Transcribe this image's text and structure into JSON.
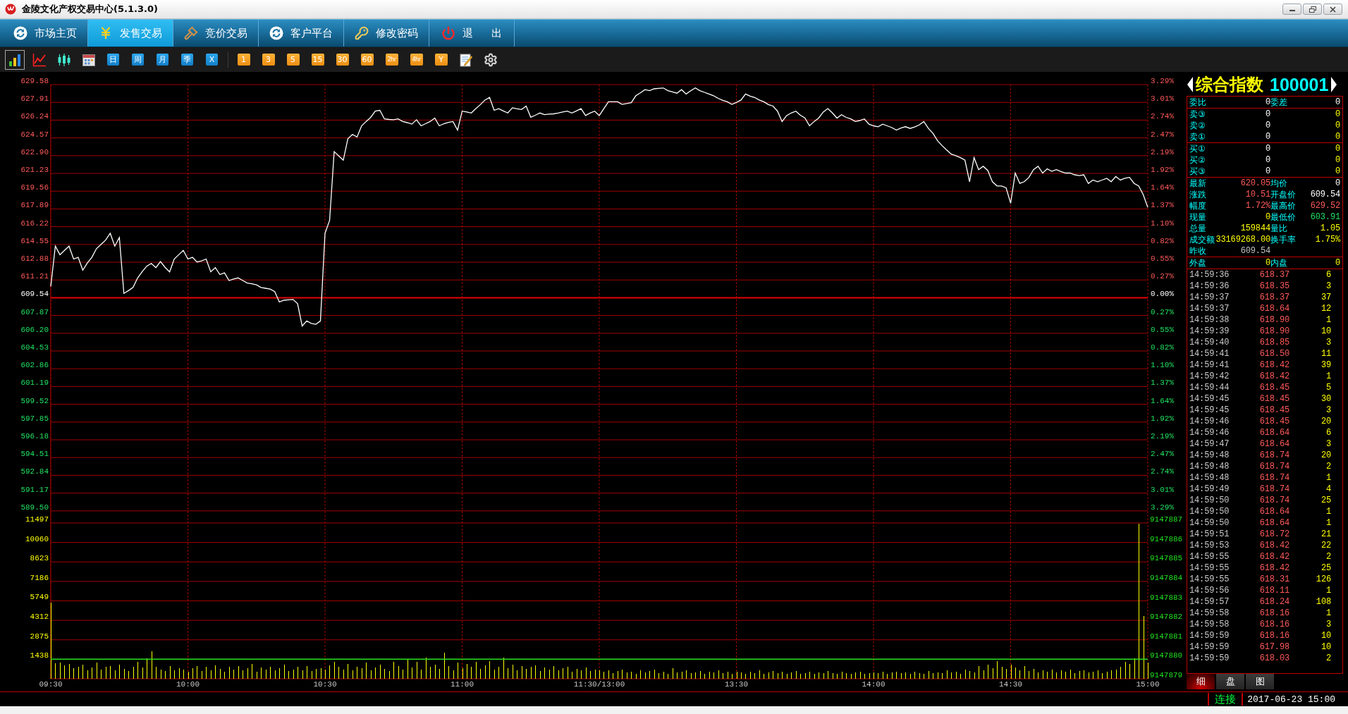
{
  "window": {
    "title": "金陵文化产权交易中心(5.1.3.0)"
  },
  "nav_tabs": [
    {
      "label": "市场主页",
      "selected": false
    },
    {
      "label": "发售交易",
      "selected": true
    },
    {
      "label": "竞价交易",
      "selected": false
    },
    {
      "label": "客户平台",
      "selected": false
    },
    {
      "label": "修改密码",
      "selected": false
    },
    {
      "label": "退 出",
      "selected": false
    }
  ],
  "toolbar": {
    "view_buttons": [
      {
        "selected": true
      },
      {
        "selected": false
      },
      {
        "selected": false
      },
      {
        "selected": false
      }
    ],
    "period_buttons": [
      "日",
      "周",
      "月",
      "季",
      "X"
    ],
    "interval_buttons": [
      "1",
      "3",
      "5",
      "15",
      "30",
      "60",
      "2hr",
      "4hr",
      "Y"
    ]
  },
  "price_chart": {
    "right_labels": [
      "3.29%",
      "3.01%",
      "2.74%",
      "2.47%",
      "2.19%",
      "1.92%",
      "1.64%",
      "1.37%",
      "1.10%",
      "0.82%",
      "0.55%",
      "0.27%",
      "0.00%",
      "0.27%",
      "0.55%",
      "0.82%",
      "1.10%",
      "1.37%",
      "1.64%",
      "1.92%",
      "2.19%",
      "2.47%",
      "2.74%",
      "3.01%",
      "3.29%"
    ],
    "chart_data": {
      "type": "line",
      "grid": true,
      "ylim": [
        589.5,
        629.58
      ],
      "yticks": [
        {
          "value": 629.58,
          "label": "629.58"
        },
        {
          "value": 627.91,
          "label": "627.91"
        },
        {
          "value": 626.24,
          "label": "626.24"
        },
        {
          "value": 624.57,
          "label": "624.57"
        },
        {
          "value": 622.9,
          "label": "622.90"
        },
        {
          "value": 621.23,
          "label": "621.23"
        },
        {
          "value": 619.56,
          "label": "619.56"
        },
        {
          "value": 617.89,
          "label": "617.89"
        },
        {
          "value": 616.22,
          "label": "616.22"
        },
        {
          "value": 614.55,
          "label": "614.55"
        },
        {
          "value": 612.88,
          "label": "612.88"
        },
        {
          "value": 611.21,
          "label": "611.21"
        },
        {
          "value": 609.54,
          "label": "609.54"
        },
        {
          "value": 607.87,
          "label": "607.87"
        },
        {
          "value": 606.2,
          "label": "606.20"
        },
        {
          "value": 604.53,
          "label": "604.53"
        },
        {
          "value": 602.86,
          "label": "602.86"
        },
        {
          "value": 601.19,
          "label": "601.19"
        },
        {
          "value": 599.52,
          "label": "599.52"
        },
        {
          "value": 597.85,
          "label": "597.85"
        },
        {
          "value": 596.18,
          "label": "596.18"
        },
        {
          "value": 594.51,
          "label": "594.51"
        },
        {
          "value": 592.84,
          "label": "592.84"
        },
        {
          "value": 591.17,
          "label": "591.17"
        },
        {
          "value": 589.5,
          "label": "589.50"
        }
      ],
      "categories": [
        null,
        null,
        null,
        null,
        null,
        null,
        null,
        null,
        null,
        null,
        null,
        null,
        null,
        null,
        null,
        null,
        null,
        null,
        null,
        null,
        null,
        null,
        null,
        null,
        null,
        null,
        null,
        null,
        null,
        null,
        null,
        null,
        null,
        null,
        null,
        null,
        null,
        null,
        null,
        null,
        null,
        null,
        null,
        null,
        null,
        null,
        null,
        null,
        null,
        null,
        null,
        null,
        null,
        null,
        null,
        null,
        null,
        null,
        null,
        null,
        null,
        null,
        null,
        null,
        null,
        null,
        null,
        null,
        null,
        null,
        null,
        null,
        null,
        null,
        null,
        null,
        null,
        null,
        null,
        null,
        null,
        null,
        null,
        null,
        null,
        null,
        null,
        null,
        null,
        null,
        null,
        null,
        null,
        null,
        null,
        null,
        null,
        null,
        null,
        null,
        null,
        null,
        null,
        null,
        null,
        null,
        null,
        null,
        null,
        null,
        null,
        null,
        null,
        null,
        null,
        null,
        null,
        null,
        null,
        null,
        null,
        null,
        null,
        null,
        null,
        null,
        null,
        null,
        null,
        null,
        null,
        null,
        null,
        null,
        null,
        null,
        null,
        null,
        null,
        null,
        null,
        null,
        null,
        null,
        null,
        null,
        null,
        null,
        null,
        null,
        null,
        null,
        null,
        null,
        null,
        null,
        null,
        null,
        null,
        null,
        null,
        null,
        null,
        null,
        null,
        null,
        null,
        null,
        null,
        null,
        null,
        null,
        null,
        null,
        null,
        null,
        null,
        null,
        null,
        null,
        null,
        null,
        null,
        null,
        null,
        null,
        null,
        null,
        null,
        null,
        null,
        null,
        null,
        null,
        null,
        null,
        null,
        null,
        null,
        null,
        null,
        null,
        null,
        null,
        null,
        null,
        null,
        null,
        null,
        null,
        null,
        null,
        null,
        null,
        null,
        null,
        null,
        null,
        null,
        null,
        null,
        null,
        null,
        null,
        null,
        null,
        null,
        null,
        null,
        null,
        null,
        null,
        null,
        null,
        null,
        null,
        null,
        null,
        null,
        null,
        null
      ],
      "series": [
        {
          "color": "#ffffff",
          "values": [
            610.6,
            614.39,
            613.58,
            613.99,
            614.39,
            613.18,
            613.34,
            612.13,
            612.8,
            613.34,
            614.15,
            614.55,
            614.96,
            615.6,
            614.39,
            615.2,
            609.95,
            610.2,
            610.51,
            611.4,
            612.0,
            612.5,
            612.77,
            612.37,
            612.94,
            612.4,
            611.97,
            613.18,
            613.58,
            613.99,
            613.18,
            613.34,
            612.9,
            613.0,
            613.18,
            611.97,
            612.37,
            611.72,
            611.88,
            611.16,
            611.3,
            611.4,
            611.16,
            610.92,
            610.85,
            610.75,
            610.51,
            610.43,
            610.35,
            610.11,
            609.14,
            609.3,
            609.34,
            609.38,
            608.98,
            606.88,
            607.36,
            607.12,
            607.04,
            607.36,
            615.6,
            616.81,
            623.28,
            622.87,
            622.47,
            624.49,
            624.89,
            624.65,
            625.7,
            626.11,
            626.5,
            627.08,
            627.16,
            626.35,
            626.3,
            626.27,
            626.35,
            626.11,
            626.0,
            625.86,
            626.27,
            625.7,
            625.9,
            626.11,
            626.43,
            625.7,
            625.9,
            626.02,
            626.11,
            625.3,
            627.08,
            627.0,
            626.91,
            627.32,
            627.7,
            628.13,
            628.37,
            627.16,
            627.32,
            627.1,
            626.91,
            627.4,
            627.3,
            627.24,
            627.56,
            626.51,
            626.7,
            626.91,
            626.75,
            626.8,
            626.83,
            626.91,
            627.0,
            627.08,
            626.91,
            627.1,
            627.32,
            626.67,
            626.9,
            627.08,
            626.67,
            627.32,
            627.96,
            627.96,
            627.96,
            627.72,
            627.8,
            627.88,
            628.53,
            628.8,
            629.1,
            629.01,
            629.18,
            629.22,
            629.26,
            629.01,
            628.9,
            628.77,
            629.1,
            628.69,
            629.0,
            629.26,
            629.01,
            628.85,
            628.7,
            628.53,
            628.29,
            628.1,
            627.96,
            627.72,
            627.9,
            628.13,
            628.69,
            628.5,
            628.37,
            628.13,
            627.96,
            627.7,
            627.56,
            627.08,
            626.11,
            626.67,
            626.91,
            627.08,
            626.7,
            626.43,
            625.7,
            626.11,
            626.43,
            627.0,
            627.32,
            626.91,
            626.43,
            626.75,
            626.5,
            626.35,
            626.11,
            626.2,
            626.35,
            625.86,
            625.7,
            625.62,
            625.86,
            625.7,
            625.54,
            625.3,
            625.5,
            625.62,
            625.46,
            625.6,
            625.78,
            626.11,
            625.46,
            625.0,
            624.3,
            623.84,
            623.44,
            623.04,
            622.9,
            622.71,
            622.47,
            620.45,
            622.71,
            621.58,
            621.9,
            621.5,
            620.45,
            620.05,
            620.05,
            619.88,
            618.43,
            621.26,
            620.29,
            620.45,
            620.85,
            621.58,
            621.9,
            621.26,
            621.66,
            621.42,
            621.58,
            621.4,
            621.26,
            621.26,
            621.1,
            621.02,
            621.1,
            620.29,
            620.61,
            620.45,
            620.6,
            620.77,
            620.45,
            620.93,
            620.61,
            620.77,
            620.85,
            620.29,
            620.05,
            619.24,
            618.03
          ]
        }
      ],
      "ref_lines": [
        {
          "axis": "y",
          "value": 609.54
        }
      ]
    }
  },
  "volume_chart": {
    "right_labels": [
      "9147887",
      "9147886",
      "9147885",
      "9147884",
      "9147883",
      "9147882",
      "9147881",
      "9147880",
      "9147879"
    ],
    "chart_data": {
      "type": "bar",
      "grid": true,
      "ylim": [
        0,
        11497
      ],
      "yticks": [
        11497,
        10060,
        8623,
        7186,
        5749,
        4312,
        2875,
        1438
      ],
      "categories": [
        "09:30",
        null,
        null,
        null,
        null,
        null,
        null,
        null,
        null,
        null,
        null,
        null,
        null,
        null,
        null,
        null,
        null,
        null,
        null,
        null,
        null,
        null,
        null,
        null,
        null,
        null,
        null,
        null,
        null,
        null,
        "10:00",
        null,
        null,
        null,
        null,
        null,
        null,
        null,
        null,
        null,
        null,
        null,
        null,
        null,
        null,
        null,
        null,
        null,
        null,
        null,
        null,
        null,
        null,
        null,
        null,
        null,
        null,
        null,
        null,
        null,
        "10:30",
        null,
        null,
        null,
        null,
        null,
        null,
        null,
        null,
        null,
        null,
        null,
        null,
        null,
        null,
        null,
        null,
        null,
        null,
        null,
        null,
        null,
        null,
        null,
        null,
        null,
        null,
        null,
        null,
        null,
        "11:00",
        null,
        null,
        null,
        null,
        null,
        null,
        null,
        null,
        null,
        null,
        null,
        null,
        null,
        null,
        null,
        null,
        null,
        null,
        null,
        null,
        null,
        null,
        null,
        null,
        null,
        null,
        null,
        null,
        null,
        "11:30/13:00",
        null,
        null,
        null,
        null,
        null,
        null,
        null,
        null,
        null,
        null,
        null,
        null,
        null,
        null,
        null,
        null,
        null,
        null,
        null,
        null,
        null,
        null,
        null,
        null,
        null,
        null,
        null,
        null,
        null,
        "13:30",
        null,
        null,
        null,
        null,
        null,
        null,
        null,
        null,
        null,
        null,
        null,
        null,
        null,
        null,
        null,
        null,
        null,
        null,
        null,
        null,
        null,
        null,
        null,
        null,
        null,
        null,
        null,
        null,
        null,
        "14:00",
        null,
        null,
        null,
        null,
        null,
        null,
        null,
        null,
        null,
        null,
        null,
        null,
        null,
        null,
        null,
        null,
        null,
        null,
        null,
        null,
        null,
        null,
        null,
        null,
        null,
        null,
        null,
        null,
        null,
        "14:30",
        null,
        null,
        null,
        null,
        null,
        null,
        null,
        null,
        null,
        null,
        null,
        null,
        null,
        null,
        null,
        null,
        null,
        null,
        null,
        null,
        null,
        null,
        null,
        null,
        null,
        null,
        null,
        null,
        null,
        "15:00"
      ],
      "series": [
        {
          "color": "#ffff00",
          "values": [
            5600,
            1150,
            1200,
            980,
            1100,
            760,
            900,
            1040,
            620,
            840,
            1180,
            700,
            880,
            960,
            640,
            1020,
            720,
            560,
            900,
            1240,
            820,
            1500,
            2010,
            860,
            700,
            580,
            940,
            620,
            800,
            680,
            540,
            760,
            920,
            580,
            880,
            640,
            1000,
            720,
            520,
            860,
            700,
            940,
            600,
            780,
            1100,
            540,
            820,
            680,
            900,
            620,
            760,
            1040,
            580,
            700,
            860,
            640,
            920,
            560,
            740,
            800,
            660,
            980,
            1250,
            860,
            700,
            1080,
            620,
            900,
            760,
            1180,
            640,
            840,
            1060,
            720,
            580,
            1250,
            940,
            700,
            1380,
            820,
            1260,
            660,
            1540,
            880,
            1050,
            720,
            1940,
            940,
            640,
            1200,
            780,
            1100,
            860,
            1240,
            720,
            980,
            1300,
            660,
            880,
            1580,
            760,
            1020,
            640,
            920,
            720,
            860,
            1000,
            580,
            840,
            700,
            960,
            620,
            780,
            880,
            540,
            720,
            640,
            820,
            560,
            700,
            600,
            520,
            640,
            420,
            580,
            700,
            460,
            540,
            380,
            620,
            480,
            560,
            700,
            440,
            500,
            380,
            760,
            460,
            540,
            620,
            420,
            480,
            560,
            380,
            520,
            460,
            600,
            420,
            540,
            380,
            500,
            460,
            380,
            540,
            420,
            620,
            360,
            480,
            560,
            400,
            520,
            340,
            460,
            580,
            380,
            440,
            520,
            360,
            480,
            400,
            560,
            440,
            380,
            500,
            420,
            340,
            460,
            540,
            380,
            420,
            480,
            420,
            500,
            380,
            460,
            540,
            400,
            480,
            360,
            520,
            440,
            380,
            560,
            420,
            480,
            400,
            620,
            460,
            520,
            380,
            700,
            560,
            480,
            940,
            620,
            1020,
            780,
            1300,
            860,
            740,
            1060,
            820,
            640,
            940,
            560,
            720,
            480,
            620,
            540,
            700,
            460,
            600,
            520,
            680,
            440,
            560,
            620,
            480,
            540,
            600,
            420,
            520,
            640,
            700,
            860,
            1240,
            1100,
            1500,
            11450,
            4620,
            1180
          ]
        }
      ],
      "ref_lines": [
        {
          "axis": "y",
          "value": 1438
        }
      ]
    }
  },
  "instrument": {
    "name": "综合指数",
    "code": "100001"
  },
  "order_ratio": {
    "left": {
      "label": "委比",
      "value": "0"
    },
    "right": {
      "label": "委差",
      "value": "0"
    }
  },
  "asks": [
    {
      "label": "卖③",
      "price": "0",
      "volume": "0"
    },
    {
      "label": "卖②",
      "price": "0",
      "volume": "0"
    },
    {
      "label": "卖①",
      "price": "0",
      "volume": "0"
    }
  ],
  "bids": [
    {
      "label": "买①",
      "price": "0",
      "volume": "0"
    },
    {
      "label": "买②",
      "price": "0",
      "volume": "0"
    },
    {
      "label": "买③",
      "price": "0",
      "volume": "0"
    }
  ],
  "quotes": [
    {
      "left": {
        "label": "最新",
        "value": "620.05",
        "color": "#ff5a5a"
      },
      "right": {
        "label": "均价",
        "value": "0",
        "color": "#ffffff"
      }
    },
    {
      "left": {
        "label": "涨跌",
        "value": "10.51",
        "color": "#ff5a5a"
      },
      "right": {
        "label": "开盘价",
        "value": "609.54",
        "color": "#ffffff"
      }
    },
    {
      "left": {
        "label": "幅度",
        "value": "1.72%",
        "color": "#ff5a5a"
      },
      "right": {
        "label": "最高价",
        "value": "629.52",
        "color": "#ff5a5a"
      }
    },
    {
      "left": {
        "label": "现量",
        "value": "0",
        "color": "#ffff00"
      },
      "right": {
        "label": "最低价",
        "value": "603.91",
        "color": "#20e060"
      }
    },
    {
      "left": {
        "label": "总量",
        "value": "159844",
        "color": "#ffff00"
      },
      "right": {
        "label": "量比",
        "value": "1.05",
        "color": "#ffff00"
      }
    },
    {
      "left": {
        "label": "成交额",
        "value": "33169268.00",
        "color": "#ffff00"
      },
      "right": {
        "label": "换手率",
        "value": "1.75%",
        "color": "#ffff00"
      }
    },
    {
      "left": {
        "label": "昨收",
        "value": "609.54",
        "color": "#c0c0c0"
      }
    }
  ],
  "outer_inner": {
    "left": {
      "label": "外盘",
      "value": "0"
    },
    "right": {
      "label": "内盘",
      "value": "0"
    }
  },
  "trades": [
    {
      "time": "14:59:36",
      "price": "618.37",
      "volume": "6"
    },
    {
      "time": "14:59:36",
      "price": "618.35",
      "volume": "3"
    },
    {
      "time": "14:59:37",
      "price": "618.37",
      "volume": "37"
    },
    {
      "time": "14:59:37",
      "price": "618.64",
      "volume": "12"
    },
    {
      "time": "14:59:38",
      "price": "618.90",
      "volume": "1"
    },
    {
      "time": "14:59:39",
      "price": "618.90",
      "volume": "10"
    },
    {
      "time": "14:59:40",
      "price": "618.85",
      "volume": "3"
    },
    {
      "time": "14:59:41",
      "price": "618.50",
      "volume": "11"
    },
    {
      "time": "14:59:41",
      "price": "618.42",
      "volume": "39"
    },
    {
      "time": "14:59:42",
      "price": "618.42",
      "volume": "1"
    },
    {
      "time": "14:59:44",
      "price": "618.45",
      "volume": "5"
    },
    {
      "time": "14:59:45",
      "price": "618.45",
      "volume": "30"
    },
    {
      "time": "14:59:45",
      "price": "618.45",
      "volume": "3"
    },
    {
      "time": "14:59:46",
      "price": "618.45",
      "volume": "20"
    },
    {
      "time": "14:59:46",
      "price": "618.64",
      "volume": "6"
    },
    {
      "time": "14:59:47",
      "price": "618.64",
      "volume": "3"
    },
    {
      "time": "14:59:48",
      "price": "618.74",
      "volume": "20"
    },
    {
      "time": "14:59:48",
      "price": "618.74",
      "volume": "2"
    },
    {
      "time": "14:59:48",
      "price": "618.74",
      "volume": "1"
    },
    {
      "time": "14:59:49",
      "price": "618.74",
      "volume": "4"
    },
    {
      "time": "14:59:50",
      "price": "618.74",
      "volume": "25"
    },
    {
      "time": "14:59:50",
      "price": "618.64",
      "volume": "1"
    },
    {
      "time": "14:59:50",
      "price": "618.64",
      "volume": "1"
    },
    {
      "time": "14:59:51",
      "price": "618.72",
      "volume": "21"
    },
    {
      "time": "14:59:53",
      "price": "618.42",
      "volume": "22"
    },
    {
      "time": "14:59:55",
      "price": "618.42",
      "volume": "2"
    },
    {
      "time": "14:59:55",
      "price": "618.42",
      "volume": "25"
    },
    {
      "time": "14:59:55",
      "price": "618.31",
      "volume": "126"
    },
    {
      "time": "14:59:56",
      "price": "618.11",
      "volume": "1"
    },
    {
      "time": "14:59:57",
      "price": "618.24",
      "volume": "108"
    },
    {
      "time": "14:59:58",
      "price": "618.16",
      "volume": "1"
    },
    {
      "time": "14:59:58",
      "price": "618.16",
      "volume": "3"
    },
    {
      "time": "14:59:59",
      "price": "618.16",
      "volume": "10"
    },
    {
      "time": "14:59:59",
      "price": "617.98",
      "volume": "10"
    },
    {
      "time": "14:59:59",
      "price": "618.03",
      "volume": "2"
    }
  ],
  "panel_tabs": [
    {
      "label": "细",
      "selected": true
    },
    {
      "label": "盘",
      "selected": false
    },
    {
      "label": "图",
      "selected": false
    }
  ],
  "status_bar": {
    "connection": "连接",
    "datetime": "2017-06-23 15:00"
  }
}
